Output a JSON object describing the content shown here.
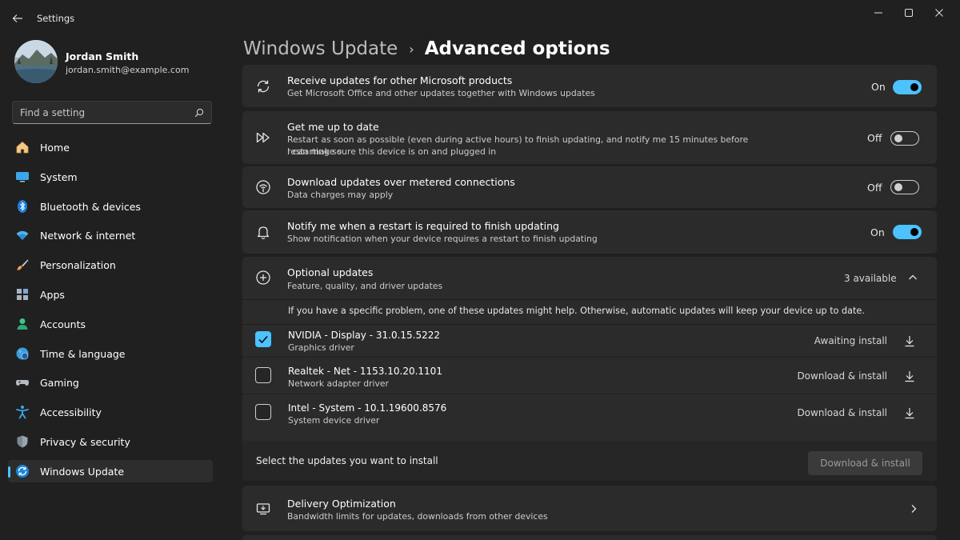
{
  "window": {
    "app_title": "Settings"
  },
  "profile": {
    "name": "Jordan Smith",
    "email": "jordan.smith@example.com"
  },
  "search": {
    "placeholder": "Find a setting"
  },
  "nav": {
    "items": [
      {
        "label": "Home",
        "icon": "home-icon"
      },
      {
        "label": "System",
        "icon": "system-icon"
      },
      {
        "label": "Bluetooth & devices",
        "icon": "bluetooth-icon"
      },
      {
        "label": "Network & internet",
        "icon": "wifi-icon"
      },
      {
        "label": "Personalization",
        "icon": "brush-icon"
      },
      {
        "label": "Apps",
        "icon": "apps-icon"
      },
      {
        "label": "Accounts",
        "icon": "accounts-icon"
      },
      {
        "label": "Time & language",
        "icon": "globe-icon"
      },
      {
        "label": "Gaming",
        "icon": "gamepad-icon"
      },
      {
        "label": "Accessibility",
        "icon": "accessibility-icon"
      },
      {
        "label": "Privacy & security",
        "icon": "shield-icon"
      },
      {
        "label": "Windows Update",
        "icon": "update-icon",
        "active": true
      }
    ]
  },
  "breadcrumb": {
    "parent": "Windows Update",
    "separator": "›",
    "current": "Advanced options"
  },
  "settings": {
    "other_products": {
      "title": "Receive updates for other Microsoft products",
      "desc": "Get Microsoft Office and other updates together with Windows updates",
      "state": "On"
    },
    "get_up_to_date": {
      "title": "Get me up to date",
      "desc_line1": "Restart as soon as possible (even during active hours) to finish updating, and notify me 15 minutes before restarting so",
      "desc_line2": "I can make sure this device is on and plugged in",
      "state": "Off"
    },
    "metered": {
      "title": "Download updates over metered connections",
      "desc": "Data charges may apply",
      "state": "Off"
    },
    "notify_restart": {
      "title": "Notify me when a restart is required to finish updating",
      "desc": "Show notification when your device requires a restart to finish updating",
      "state": "On"
    }
  },
  "optional_updates": {
    "title": "Optional updates",
    "desc": "Feature, quality, and driver updates",
    "count": "3 available",
    "info": "If you have a specific problem, one of these updates might help. Otherwise, automatic updates will keep your device up to date.",
    "updates": [
      {
        "name": "NVIDIA - Display - 31.0.15.5222",
        "type": "Graphics driver",
        "status": "Awaiting install",
        "checked": true
      },
      {
        "name": "Realtek - Net - 1153.10.20.1101",
        "type": "Network adapter driver",
        "status": "Download & install",
        "checked": false
      },
      {
        "name": "Intel - System - 10.1.19600.8576",
        "type": "System device driver",
        "status": "Download & install",
        "checked": false
      }
    ],
    "select_hint": "Select the updates you want to install",
    "install_button": "Download & install"
  },
  "delivery": {
    "title": "Delivery Optimization",
    "desc": "Bandwidth limits for updates, downloads from other devices"
  },
  "colors": {
    "accent": "#4cc2ff",
    "background": "#202020",
    "card": "#2b2b2b"
  }
}
